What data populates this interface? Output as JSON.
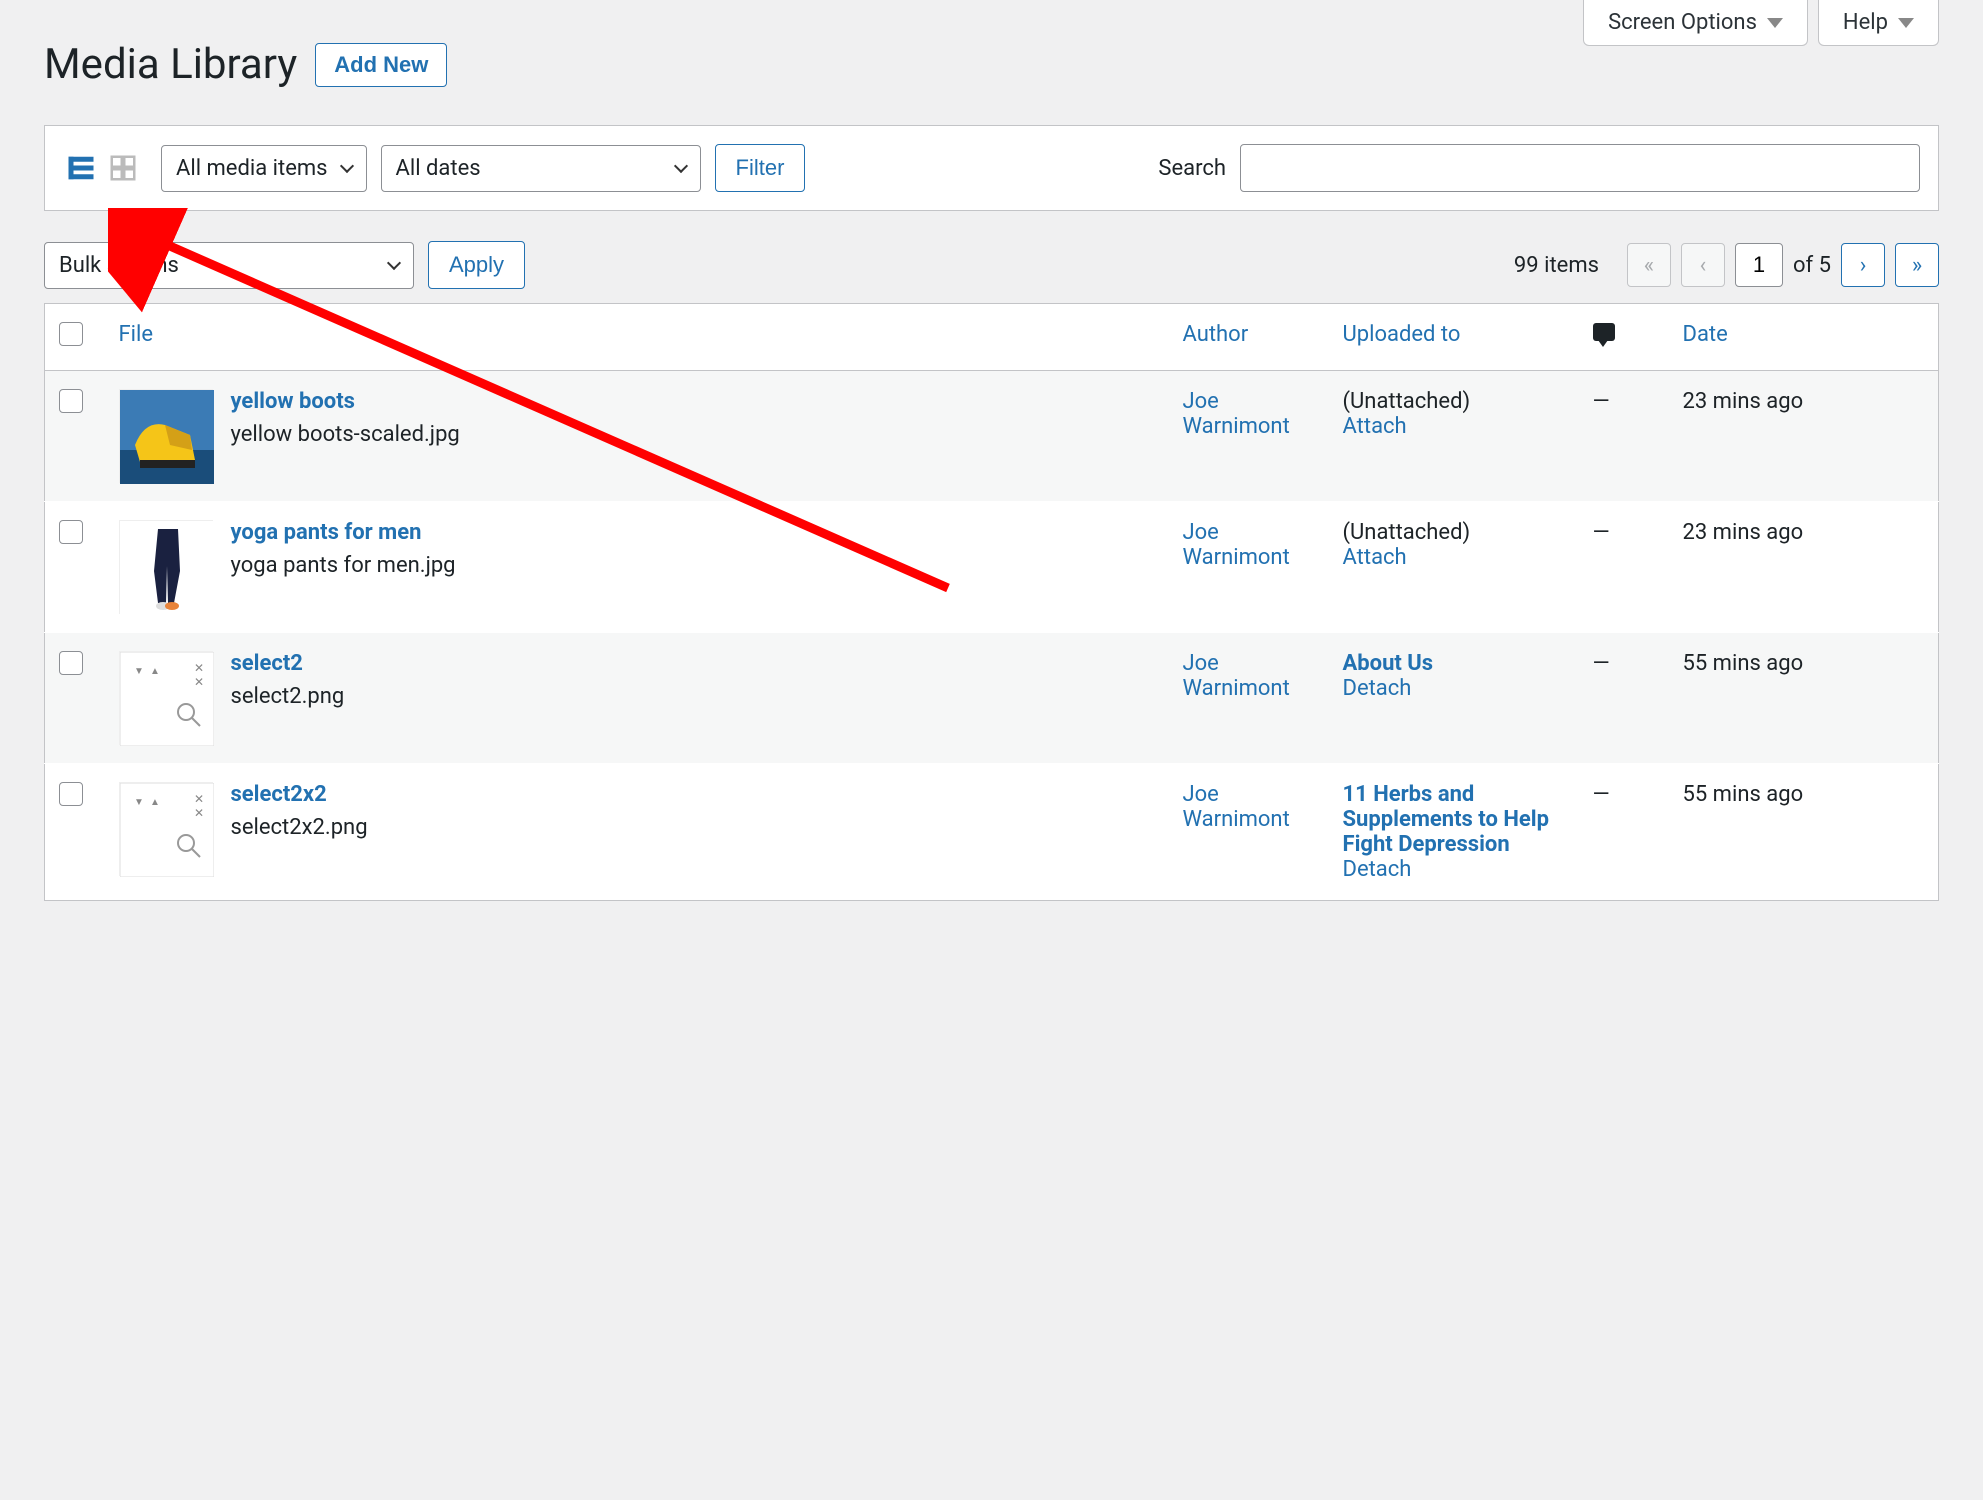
{
  "top": {
    "screen_options": "Screen Options",
    "help": "Help"
  },
  "page_title": "Media Library",
  "add_new_label": "Add New",
  "filters": {
    "media_type": "All media items",
    "dates": "All dates",
    "filter_label": "Filter",
    "search_label": "Search"
  },
  "bulk": {
    "bulk_label": "Bulk actions",
    "apply_label": "Apply"
  },
  "pagination": {
    "items_text": "99 items",
    "current": "1",
    "total_text": "of 5"
  },
  "columns": {
    "file": "File",
    "author": "Author",
    "uploaded": "Uploaded to",
    "date": "Date"
  },
  "rows": [
    {
      "title": "yellow boots",
      "filename": "yellow boots-scaled.jpg",
      "author": "Joe Warnimont",
      "uploaded_text": "(Unattached)",
      "action": "Attach",
      "uploaded_link": false,
      "comments": "—",
      "date": "23 mins ago",
      "thumb_type": "boots"
    },
    {
      "title": "yoga pants for men",
      "filename": "yoga pants for men.jpg",
      "author": "Joe Warnimont",
      "uploaded_text": "(Unattached)",
      "action": "Attach",
      "uploaded_link": false,
      "comments": "—",
      "date": "23 mins ago",
      "thumb_type": "pants"
    },
    {
      "title": "select2",
      "filename": "select2.png",
      "author": "Joe Warnimont",
      "uploaded_text": "About Us",
      "action": "Detach",
      "uploaded_link": true,
      "comments": "—",
      "date": "55 mins ago",
      "thumb_type": "select"
    },
    {
      "title": "select2x2",
      "filename": "select2x2.png",
      "author": "Joe Warnimont",
      "uploaded_text": "11 Herbs and Supplements to Help Fight Depression",
      "action": "Detach",
      "uploaded_link": true,
      "comments": "—",
      "date": "55 mins ago",
      "thumb_type": "select"
    }
  ]
}
